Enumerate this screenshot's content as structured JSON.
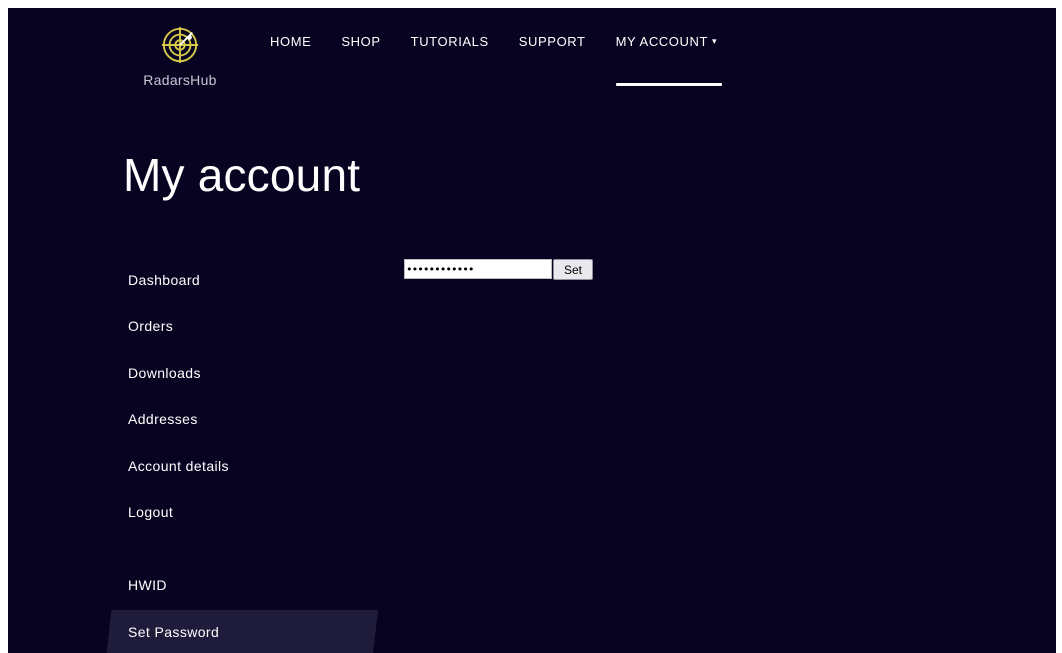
{
  "brand": {
    "name": "RadarsHub",
    "icon": "radar-crosshair-icon",
    "accent_color": "#d6c94a"
  },
  "nav": {
    "items": [
      {
        "label": "HOME"
      },
      {
        "label": "SHOP"
      },
      {
        "label": "TUTORIALS"
      },
      {
        "label": "SUPPORT"
      },
      {
        "label": "MY ACCOUNT",
        "active": true,
        "has_dropdown": true,
        "caret": "▾"
      }
    ]
  },
  "page": {
    "title": "My account"
  },
  "sidebar": {
    "items": [
      {
        "label": "Dashboard"
      },
      {
        "label": "Orders"
      },
      {
        "label": "Downloads"
      },
      {
        "label": "Addresses"
      },
      {
        "label": "Account details"
      },
      {
        "label": "Logout"
      },
      {
        "label": "HWID"
      },
      {
        "label": "Set Password",
        "active": true
      }
    ]
  },
  "password_form": {
    "value": "••••••••••••",
    "button_label": "Set"
  },
  "colors": {
    "background": "#070320",
    "active_item_bg": "#1f1b3a",
    "text": "#ffffff"
  }
}
